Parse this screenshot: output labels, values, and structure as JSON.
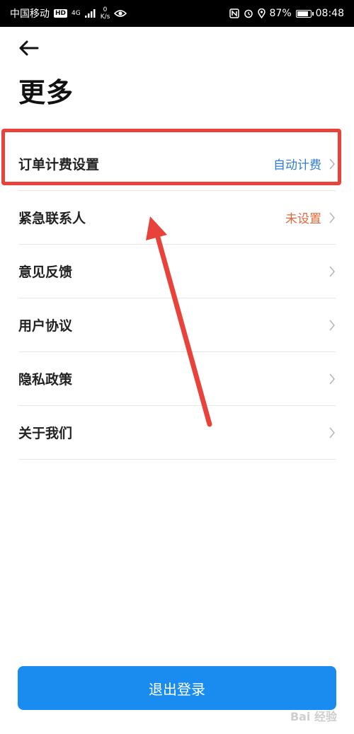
{
  "status_bar": {
    "carrier": "中国移动",
    "hd": "HD",
    "net": "4G",
    "speed_value": "0",
    "speed_unit": "K/s",
    "battery": "87%",
    "battery_level": 0.87,
    "time": "08:48"
  },
  "page": {
    "title": "更多"
  },
  "menu": {
    "items": [
      {
        "label": "订单计费设置",
        "value": "自动计费"
      },
      {
        "label": "紧急联系人",
        "value": "未设置"
      },
      {
        "label": "意见反馈",
        "value": ""
      },
      {
        "label": "用户协议",
        "value": ""
      },
      {
        "label": "隐私政策",
        "value": ""
      },
      {
        "label": "关于我们",
        "value": ""
      }
    ]
  },
  "logout_label": "退出登录",
  "watermark": "Bai 经验",
  "colors": {
    "primary_button": "#1a8cf0",
    "value_blue": "#2e7cd6",
    "value_orange": "#e0673a",
    "annotation_red": "#e8433a"
  }
}
